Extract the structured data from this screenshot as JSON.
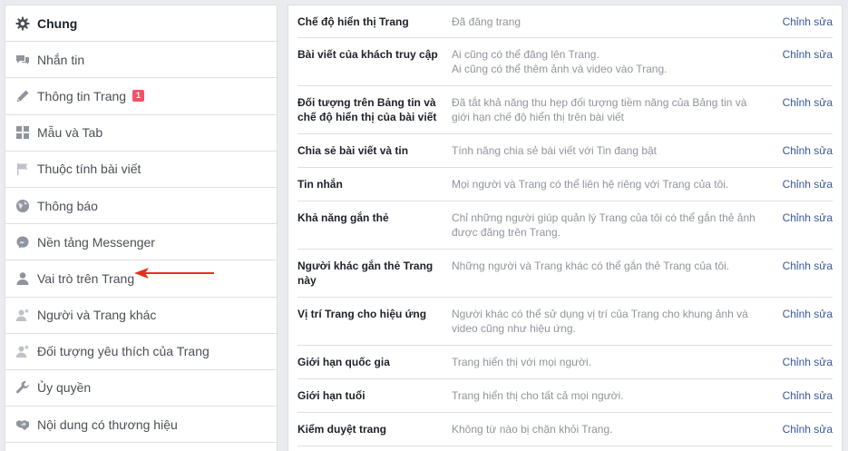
{
  "sidebar": {
    "items": [
      {
        "label": "Chung",
        "icon": "gear-icon",
        "active": true
      },
      {
        "label": "Nhắn tin",
        "icon": "chat-bubbles-icon"
      },
      {
        "label": "Thông tin Trang",
        "icon": "pencil-icon",
        "badge": "1"
      },
      {
        "label": "Mẫu và Tab",
        "icon": "grid-icon"
      },
      {
        "label": "Thuộc tính bài viết",
        "icon": "flag-icon"
      },
      {
        "label": "Thông báo",
        "icon": "globe-icon"
      },
      {
        "label": "Nền tảng Messenger",
        "icon": "messenger-icon"
      },
      {
        "label": "Vai trò trên Trang",
        "icon": "person-icon"
      },
      {
        "label": "Người và Trang khác",
        "icon": "person-star-icon"
      },
      {
        "label": "Đối tượng yêu thích của Trang",
        "icon": "person-star-icon"
      },
      {
        "label": "Ủy quyền",
        "icon": "wrench-icon"
      },
      {
        "label": "Nội dung có thương hiệu",
        "icon": "handshake-icon"
      }
    ]
  },
  "settings": {
    "edit_label": "Chỉnh sửa",
    "rows": [
      {
        "label": "Chế độ hiển thị Trang",
        "lines": [
          "Đã đăng trang"
        ]
      },
      {
        "label": "Bài viết của khách truy cập",
        "lines": [
          "Ai cũng có thể đăng lên Trang.",
          "Ai cũng có thể thêm ảnh và video vào Trang."
        ]
      },
      {
        "label": "Đối tượng trên Bảng tin và chế độ hiển thị của bài viết",
        "lines": [
          "Đã tắt khả năng thu hẹp đối tượng tiềm năng của Bảng tin và",
          "giới hạn chế độ hiển thị trên bài viết"
        ]
      },
      {
        "label": "Chia sẻ bài viết và tin",
        "lines": [
          "Tính năng chia sẻ bài viết với Tin đang bật"
        ]
      },
      {
        "label": "Tin nhắn",
        "lines": [
          "Mọi người và Trang có thể liên hệ riêng với Trang của tôi."
        ]
      },
      {
        "label": "Khả năng gắn thẻ",
        "lines": [
          "Chỉ những người giúp quản lý Trang của tôi có thể gắn thẻ ảnh",
          "được đăng trên Trang."
        ]
      },
      {
        "label": "Người khác gắn thẻ Trang này",
        "lines": [
          "Những người và Trang khác có thể gắn thẻ Trang của tôi."
        ]
      },
      {
        "label": "Vị trí Trang cho hiệu ứng",
        "lines": [
          "Người khác có thể sử dụng vị trí của Trang cho khung ảnh và",
          "video cũng như hiệu ứng."
        ]
      },
      {
        "label": "Giới hạn quốc gia",
        "lines": [
          "Trang hiển thị với mọi người."
        ]
      },
      {
        "label": "Giới hạn tuổi",
        "lines": [
          "Trang hiển thị cho tất cả mọi người."
        ]
      },
      {
        "label": "Kiểm duyệt trang",
        "lines": [
          "Không từ nào bị chặn khỏi Trang."
        ]
      }
    ]
  },
  "colors": {
    "background": "#e9ebee",
    "border": "#dddfe2",
    "link": "#365899",
    "label": "#1d2129",
    "muted": "#90949c",
    "badge": "#f25268",
    "arrow": "#e3311d"
  }
}
